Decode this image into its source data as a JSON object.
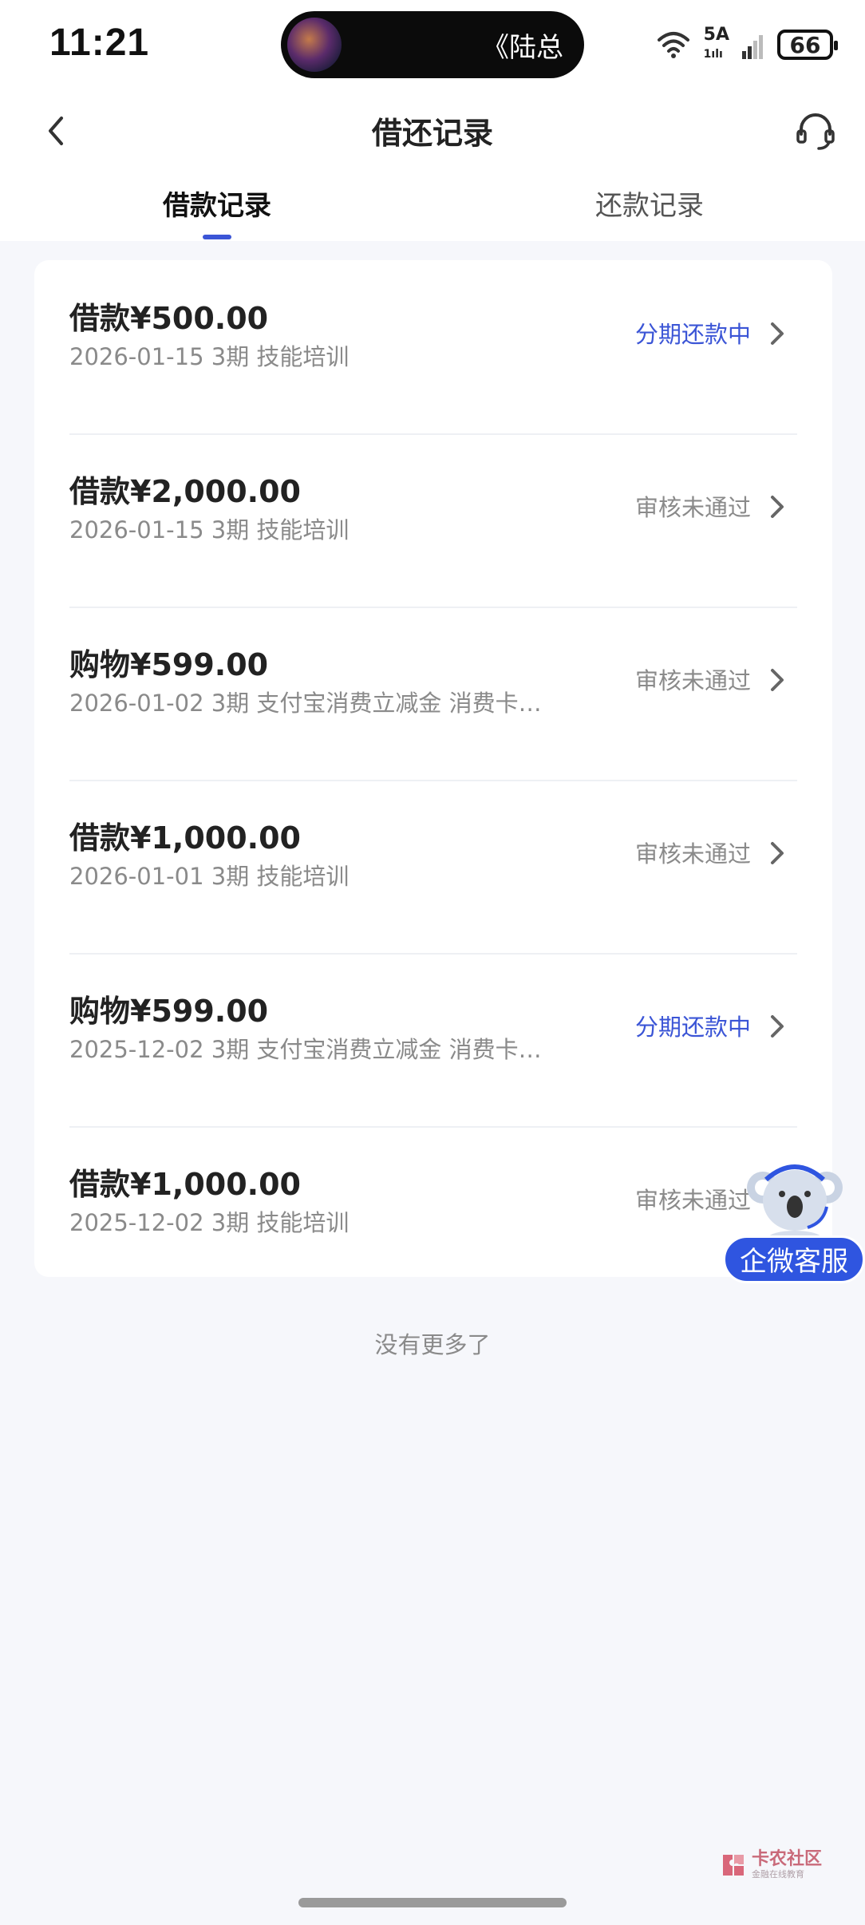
{
  "status_bar": {
    "time": "11:21",
    "now_playing": "《陆总",
    "network": "5A",
    "network_sub": "1ılı",
    "battery": "66"
  },
  "header": {
    "title": "借还记录",
    "back_icon": "chevron-left-icon",
    "service_icon": "headset-icon"
  },
  "tabs": [
    {
      "label": "借款记录",
      "active": true
    },
    {
      "label": "还款记录",
      "active": false
    }
  ],
  "records": [
    {
      "title": "借款¥500.00",
      "sub": "2026-01-15 3期  技能培训",
      "status": "分期还款中",
      "status_type": "active"
    },
    {
      "title": "借款¥2,000.00",
      "sub": "2026-01-15 3期  技能培训",
      "status": "审核未通过",
      "status_type": "rejected"
    },
    {
      "title": "购物¥599.00",
      "sub": "2026-01-02 3期  支付宝消费立减金 消费卡…",
      "status": "审核未通过",
      "status_type": "rejected"
    },
    {
      "title": "借款¥1,000.00",
      "sub": "2026-01-01 3期  技能培训",
      "status": "审核未通过",
      "status_type": "rejected"
    },
    {
      "title": "购物¥599.00",
      "sub": "2025-12-02 3期  支付宝消费立减金 消费卡…",
      "status": "分期还款中",
      "status_type": "active"
    },
    {
      "title": "借款¥1,000.00",
      "sub": "2025-12-02 3期  技能培训",
      "status": "审核未通过",
      "status_type": "rejected"
    }
  ],
  "list_footer": "没有更多了",
  "floating_service": {
    "label": "企微客服",
    "icon": "koala-mascot-icon"
  },
  "watermark": {
    "main": "卡农社区",
    "sub": "金融在线教育"
  },
  "colors": {
    "accent": "#3b55d6",
    "muted": "#8a8a8a",
    "background": "#f6f7fb",
    "service_pill": "#2f55e0"
  }
}
